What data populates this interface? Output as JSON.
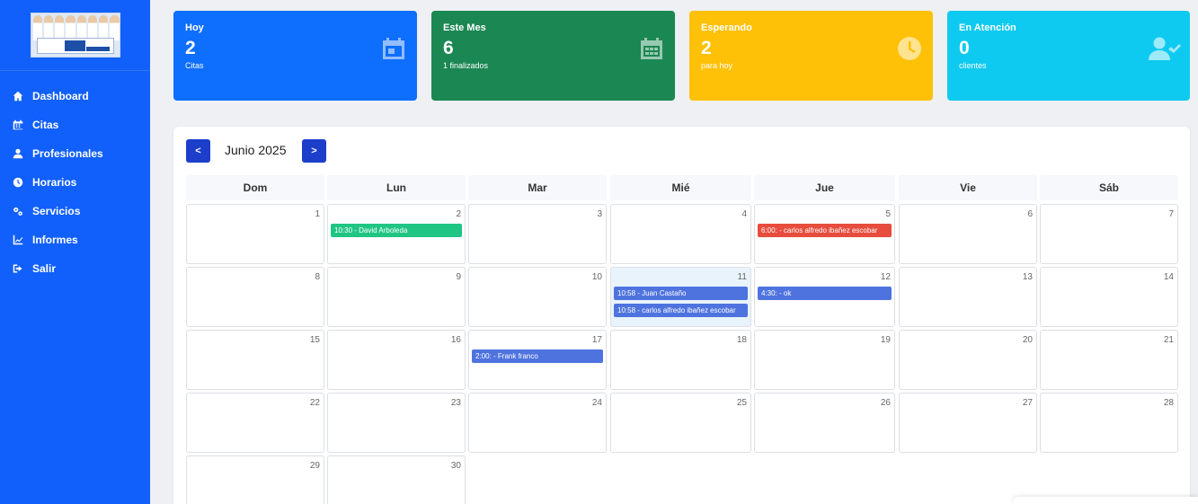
{
  "sidebar": {
    "items": [
      {
        "label": "Dashboard",
        "icon": "home-icon"
      },
      {
        "label": "Citas",
        "icon": "calendar-icon"
      },
      {
        "label": "Profesionales",
        "icon": "user-icon"
      },
      {
        "label": "Horarios",
        "icon": "clock-icon"
      },
      {
        "label": "Servicios",
        "icon": "gears-icon"
      },
      {
        "label": "Informes",
        "icon": "chart-line-icon"
      },
      {
        "label": "Salir",
        "icon": "sign-out-icon"
      }
    ]
  },
  "logo": {
    "icon": "clinic-logo"
  },
  "stats": [
    {
      "title": "Hoy",
      "value": "2",
      "sub": "Citas",
      "color": "#0e6efd",
      "icon": "calendar-icon"
    },
    {
      "title": "Este Mes",
      "value": "6",
      "sub": "1 finalizados",
      "color": "#1b8753",
      "icon": "calendar-grid-icon"
    },
    {
      "title": "Esperando",
      "value": "2",
      "sub": "para hoy",
      "color": "#fec107",
      "icon": "clock-icon"
    },
    {
      "title": "En Atención",
      "value": "0",
      "sub": "clientes",
      "color": "#0fcaf0",
      "icon": "user-check-icon"
    }
  ],
  "calendar": {
    "month_label": "Junio 2025",
    "prev_label": "<",
    "next_label": ">",
    "weekdays": [
      "Dom",
      "Lun",
      "Mar",
      "Mié",
      "Jue",
      "Vie",
      "Sáb"
    ],
    "today": 11,
    "weeks": [
      [
        1,
        2,
        3,
        4,
        5,
        6,
        7
      ],
      [
        8,
        9,
        10,
        11,
        12,
        13,
        14
      ],
      [
        15,
        16,
        17,
        18,
        19,
        20,
        21
      ],
      [
        22,
        23,
        24,
        25,
        26,
        27,
        28
      ],
      [
        29,
        30
      ]
    ],
    "events": [
      {
        "day": 2,
        "label": "10:30 - David Arboleda",
        "color": "#20c584"
      },
      {
        "day": 5,
        "label": "6:00: - carlos alfredo ibañez escobar",
        "color": "#e74c3c"
      },
      {
        "day": 11,
        "label": "10:58 - Juan Castaño",
        "color": "#4e73df"
      },
      {
        "day": 11,
        "label": "10:58 - carlos alfredo ibañez escobar",
        "color": "#4e73df"
      },
      {
        "day": 12,
        "label": "4:30: - ok",
        "color": "#4e73df"
      },
      {
        "day": 17,
        "label": "2:00: - Frank franco",
        "color": "#4e73df"
      }
    ]
  }
}
